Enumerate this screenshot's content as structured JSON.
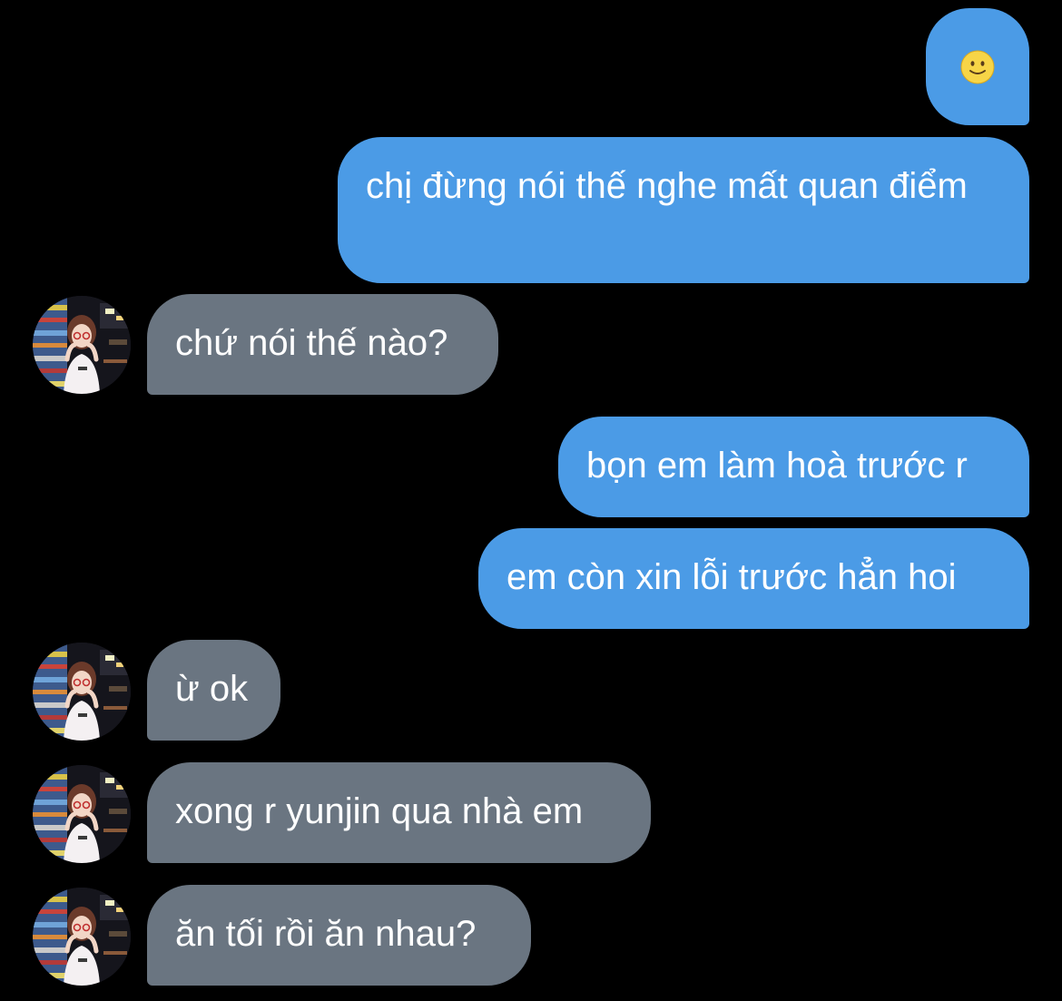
{
  "conversation": {
    "contact_avatar": "avatar-photo-icon",
    "colors": {
      "background": "#000000",
      "outgoing_bubble": "#4b9be6",
      "incoming_bubble": "#6a7581",
      "text": "#ffffff"
    },
    "messages": [
      {
        "direction": "outgoing",
        "type": "emoji",
        "emoji_icon": "slightly-smiling-face-icon"
      },
      {
        "direction": "outgoing",
        "text": "chị đừng nói thế nghe mất quan điểm"
      },
      {
        "direction": "incoming",
        "text": "chứ nói thế nào?"
      },
      {
        "direction": "outgoing",
        "text": "bọn em làm hoà trước r"
      },
      {
        "direction": "outgoing",
        "text": "em còn xin lỗi trước hẳn hoi"
      },
      {
        "direction": "incoming",
        "text": "ừ ok"
      },
      {
        "direction": "incoming",
        "text": "xong r yunjin qua nhà em"
      },
      {
        "direction": "incoming",
        "text": "ăn tối rồi ăn nhau?"
      }
    ]
  }
}
